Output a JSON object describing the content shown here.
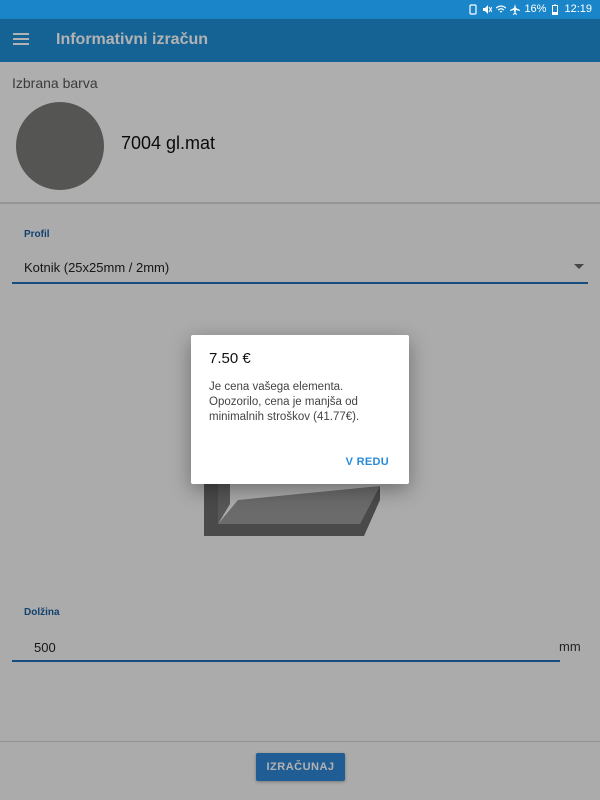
{
  "status_bar": {
    "battery": "16%",
    "time": "12:19"
  },
  "app_bar": {
    "title": "Informativni izračun",
    "menu_icon": "hamburger-menu-icon"
  },
  "color_card": {
    "label": "Izbrana barva",
    "color_name": "7004 gl.mat",
    "swatch_color": "#7a7a77"
  },
  "profile": {
    "label": "Profil",
    "selected": "Kotnik (25x25mm / 2mm)"
  },
  "length": {
    "label": "Dolžina",
    "value": "500",
    "unit": "mm"
  },
  "calculate_button": "IZRAČUNAJ",
  "dialog": {
    "title": "7.50 €",
    "message": "Je cena vašega elementa. Opozorilo, cena je manjša od minimalnih stroškov (41.77€).",
    "ok_button": "V REDU"
  }
}
